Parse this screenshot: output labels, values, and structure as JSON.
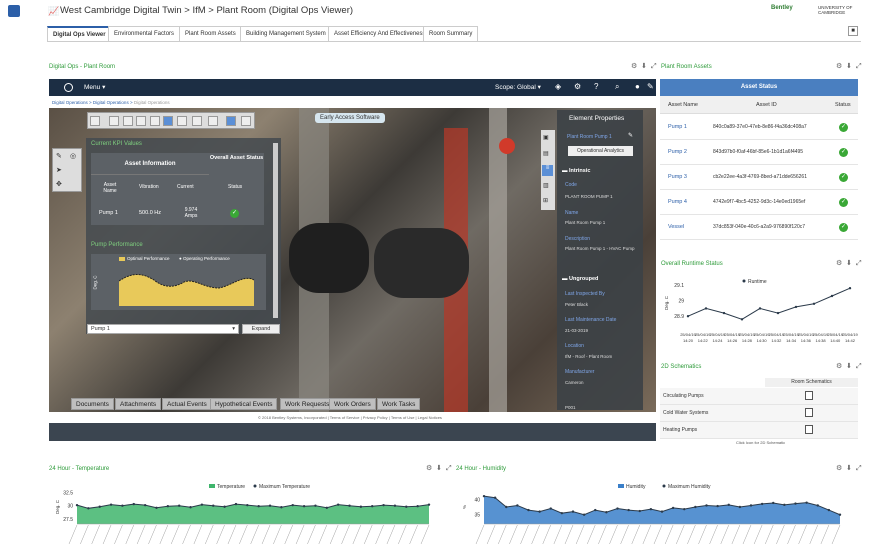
{
  "header": {
    "title": "West Cambridge Digital Twin > IfM > Plant Room (Digital Ops Viewer)",
    "logos": [
      "Bentley",
      "UNIVERSITY OF CAMBRIDGE"
    ]
  },
  "tabs": [
    "Digital Ops Viewer",
    "Environmental Factors",
    "Plant Room Assets",
    "Building Management System",
    "Asset Efficiency And Effectiveness",
    "Room Summary"
  ],
  "viewer": {
    "panel_title": "Digital Ops - Plant Room",
    "menu_label": "Menu",
    "scope_label": "Scope: Global",
    "breadcrumb": [
      "Digital Operations",
      "Digital Operations",
      "Digital Operations"
    ],
    "early_access": "Early Access Software",
    "kpi_title": "Current KPI Values",
    "asset_info": "Asset Information",
    "overall_status": "Overall Asset Status",
    "cols": [
      "Asset Name",
      "Vibration",
      "Current",
      "Status"
    ],
    "row": {
      "name": "Pump 1",
      "vibration": "500.0 Hz",
      "current": "9.974 Amps"
    },
    "pump_perf": "Pump Performance",
    "legend": [
      "Optimal Performance",
      "Operating Performance"
    ],
    "ylabel": "Deg. C",
    "select_value": "Pump 1",
    "expand": "Expand",
    "bottom_tabs": [
      "Documents",
      "Attachments",
      "Actual Events",
      "Hypothetical Events",
      "Work Requests",
      "Work Orders",
      "Work Tasks"
    ],
    "footer": "© 2018 Bentley Systems, Incorporated | Terms of Service | Privacy Policy | Terms of Use | Legal Notices"
  },
  "element_props": {
    "title": "Element Properties",
    "name": "Plant Room Pump 1",
    "analytics_btn": "Operational Analytics",
    "intrinsic": "Intrinsic",
    "ungrouped": "Ungrouped",
    "fields": [
      {
        "label": "Code",
        "value": "PLANT ROOM PUMP 1"
      },
      {
        "label": "Name",
        "value": "Plant Room Pump 1"
      },
      {
        "label": "Description",
        "value": "Plant Room Pump 1 - HVAC Pump"
      }
    ],
    "fields2": [
      {
        "label": "Last Inspected By",
        "value": "Peter Black"
      },
      {
        "label": "Last Maintenance Date",
        "value": "21-03-2019"
      },
      {
        "label": "Location",
        "value": "IfM - Roof - Plant Room"
      },
      {
        "label": "Manufacturer",
        "value": "Cameron"
      },
      {
        "label": "",
        "value": "P001"
      }
    ]
  },
  "assets": {
    "panel_title": "Plant Room Assets",
    "header": "Asset Status",
    "cols": [
      "Asset Name",
      "Asset ID",
      "Status"
    ],
    "rows": [
      {
        "name": "Pump 1",
        "id": "840c0a89-37e0-47eb-8e86-f4a36dc408a7"
      },
      {
        "name": "Pump 2",
        "id": "843d97b0-f0af-46bf-85e6-1b1d1a6f4495"
      },
      {
        "name": "Pump 3",
        "id": "cb2e22ee-4a3f-4769-8bed-a71dde656261"
      },
      {
        "name": "Pump 4",
        "id": "4742e9f7-4bc5-4252-9d3c-14e0ed1965ef"
      },
      {
        "name": "Vessel",
        "id": "37dc853f-040e-40c6-a2a9-976890f120c7"
      }
    ]
  },
  "runtime": {
    "panel_title": "Overall Runtime Status",
    "chart_data": {
      "type": "line",
      "series": [
        {
          "name": "Runtime",
          "values": [
            28.9,
            28.95,
            28.92,
            28.88,
            28.95,
            28.92,
            28.96,
            28.98,
            29.03,
            29.08
          ]
        }
      ],
      "categories": [
        "25/04/19 14:20",
        "25/04/19 14:22",
        "25/04/19 14:24",
        "25/04/19 14:26",
        "25/04/19 14:28",
        "25/04/19 14:30",
        "25/04/19 14:32",
        "25/04/19 14:34",
        "25/04/19 14:36",
        "25/04/19 14:38"
      ],
      "x_tick_labels": [
        "25/04/19 14:20",
        "25/04/19 14:22",
        "25/04/19 14:24",
        "25/04/19 14:26",
        "25/04/19 14:28",
        "25/04/19 14:30",
        "25/04/19 14:32",
        "25/04/19 14:34",
        "25/04/19 14:36",
        "25/04/19 14:38",
        "25/04/19 14:40",
        "25/04/19 14:42"
      ],
      "x_tick_short": [
        "14:20",
        "14:22",
        "14:24",
        "14:26",
        "14:28",
        "14:30",
        "14:32",
        "14:34",
        "14:36",
        "14:38",
        "14:40",
        "14:42"
      ],
      "yticks": [
        29.1,
        29,
        28.9
      ],
      "ylabel": "Deg. C",
      "ylim": [
        28.85,
        29.12
      ]
    }
  },
  "schematics": {
    "panel_title": "2D Schematics",
    "col": "Room Schematics",
    "rows": [
      "Circulating Pumps",
      "Cold Water Systems",
      "Heating Pumps"
    ],
    "note": "Click Icon for 2D Schematic"
  },
  "temperature": {
    "panel_title": "24 Hour - Temperature",
    "chart_data": {
      "type": "area",
      "series": [
        {
          "name": "Temperature",
          "values": [
            30.1,
            29.5,
            29.8,
            30.2,
            30.0,
            30.3,
            30.1,
            29.6,
            29.9,
            30.0,
            29.7,
            30.2,
            30.0,
            29.8,
            30.3,
            30.1,
            29.9,
            30.0,
            29.7,
            30.1,
            29.9,
            30.0,
            29.6,
            30.2,
            30.0,
            29.8,
            29.9,
            30.1,
            30.0,
            29.8,
            29.9,
            30.2
          ]
        },
        {
          "name": "Maximum Temperature",
          "values": [
            30.1,
            29.5,
            29.8,
            30.2,
            30.0,
            30.3,
            30.1,
            29.6,
            29.9,
            30.0,
            29.7,
            30.2,
            30.0,
            29.8,
            30.3,
            30.1,
            29.9,
            30.0,
            29.7,
            30.1,
            29.9,
            30.0,
            29.6,
            30.2,
            30.0,
            29.8,
            29.9,
            30.1,
            30.0,
            29.8,
            29.9,
            30.2
          ]
        }
      ],
      "yticks": [
        32.5,
        30,
        27.5
      ],
      "ylabel": "Deg. C",
      "ylim": [
        26.5,
        33
      ],
      "colors": [
        "#3fb56c",
        "#2b3a4a"
      ]
    }
  },
  "humidity": {
    "panel_title": "24 Hour - Humidity",
    "chart_data": {
      "type": "area",
      "series": [
        {
          "name": "Humidity",
          "values": [
            41,
            40.5,
            37.5,
            38,
            36.5,
            36,
            37,
            35.5,
            36,
            35,
            36.5,
            35.8,
            37,
            36.5,
            36.2,
            36.8,
            36,
            37.2,
            36.8,
            37.5,
            38,
            37.8,
            38.2,
            37.5,
            38,
            38.5,
            38.8,
            38.2,
            38.6,
            38.9,
            38,
            36.5,
            35
          ]
        },
        {
          "name": "Maximum Humidity",
          "values": [
            41,
            40.5,
            37.5,
            38,
            36.5,
            36,
            37,
            35.5,
            36,
            35,
            36.5,
            35.8,
            37,
            36.5,
            36.2,
            36.8,
            36,
            37.2,
            36.8,
            37.5,
            38,
            37.8,
            38.2,
            37.5,
            38,
            38.5,
            38.8,
            38.2,
            38.6,
            38.9,
            38,
            36.5,
            35
          ]
        }
      ],
      "yticks": [
        40,
        35
      ],
      "ylabel": "%",
      "ylim": [
        32,
        43
      ],
      "colors": [
        "#3a7fc9",
        "#2b3a4a"
      ]
    }
  }
}
